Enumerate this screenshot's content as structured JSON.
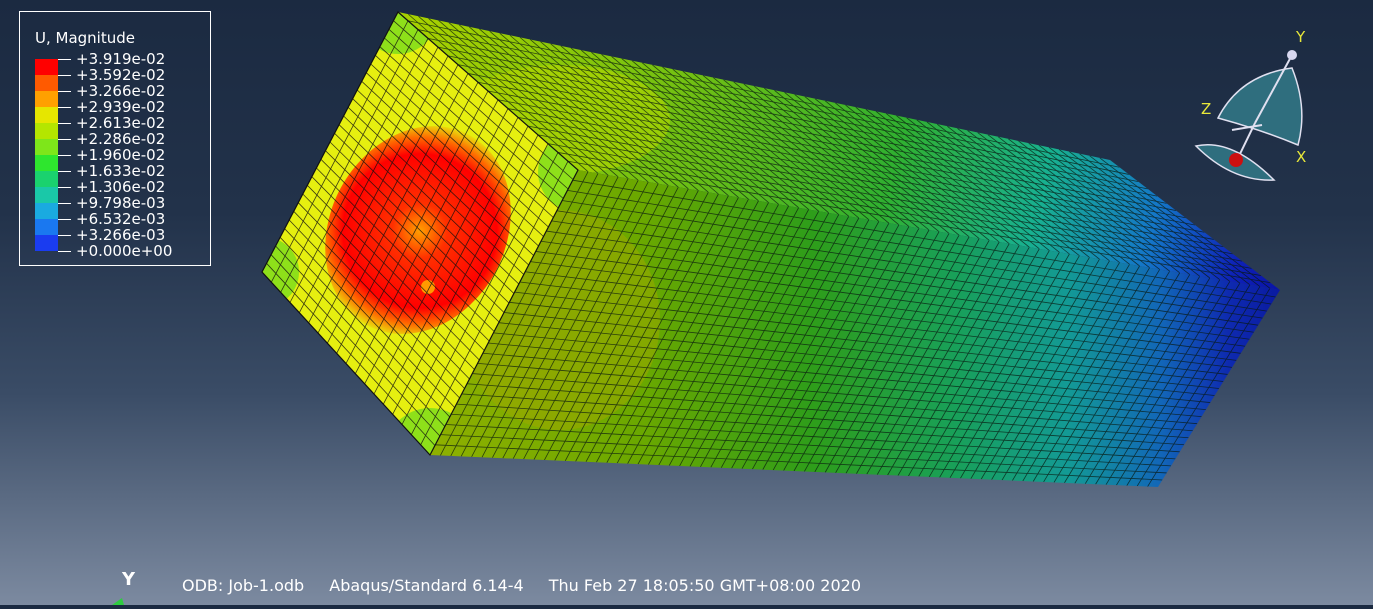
{
  "legend": {
    "title": "U, Magnitude",
    "labels": [
      "+3.919e-02",
      "+3.592e-02",
      "+3.266e-02",
      "+2.939e-02",
      "+2.613e-02",
      "+2.286e-02",
      "+1.960e-02",
      "+1.633e-02",
      "+1.306e-02",
      "+9.798e-03",
      "+6.532e-03",
      "+3.266e-03",
      "+0.000e+00"
    ],
    "colors": [
      "#ff0000",
      "#ff5a00",
      "#ffa000",
      "#e6e600",
      "#b4e600",
      "#7ee61a",
      "#2ee62e",
      "#1ad26e",
      "#1ac8a8",
      "#1aaae0",
      "#1a78f0",
      "#1a3cf0"
    ]
  },
  "triad": {
    "x": "X",
    "y": "Y",
    "z": "Z"
  },
  "bottom_triad": {
    "y": "Y"
  },
  "status": {
    "odb": "ODB: Job-1.odb",
    "solver": "Abaqus/Standard 6.14-4",
    "date": "Thu Feb 27 18:05:50 GMT+08:00 2020"
  }
}
